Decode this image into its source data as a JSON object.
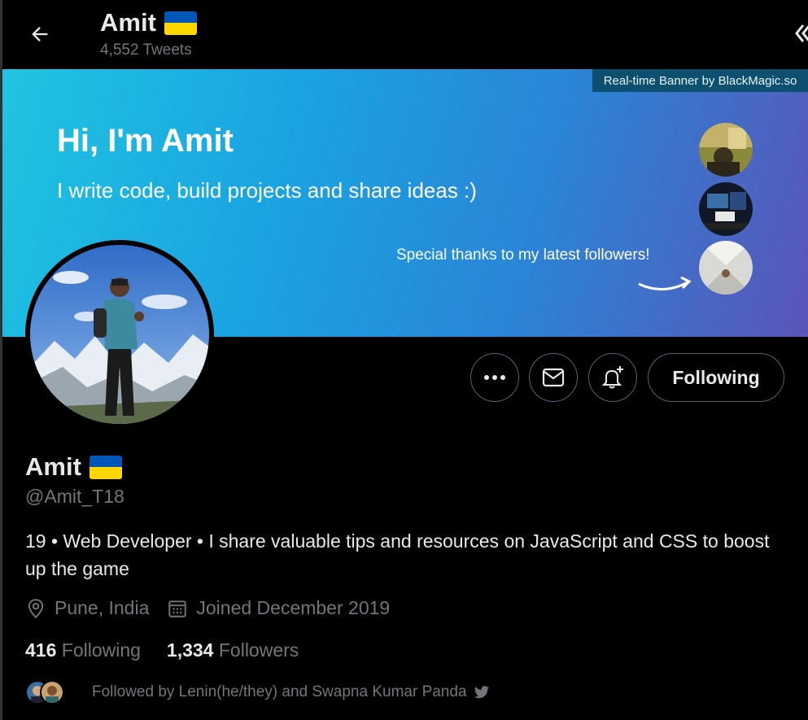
{
  "header": {
    "name": "Amit",
    "tweet_count": "4,552 Tweets",
    "flag": "ukraine-flag"
  },
  "banner": {
    "credit": "Real-time Banner by BlackMagic.so",
    "title": "Hi, I'm Amit",
    "subtitle": "I write code, build projects and share ideas :)",
    "thanks": "Special thanks to my latest followers!"
  },
  "actions": {
    "more_icon": "more-dots-icon",
    "message_icon": "envelope-icon",
    "notify_icon": "bell-plus-icon",
    "following_label": "Following"
  },
  "profile": {
    "name": "Amit",
    "handle": "@Amit_T18",
    "bio": "19 • Web Developer • I share valuable tips and resources on JavaScript and CSS to boost up the game",
    "location": "Pune, India",
    "joined": "Joined December 2019",
    "following_count": "416",
    "following_label": "Following",
    "followers_count": "1,334",
    "followers_label": "Followers",
    "followed_by": "Followed by Lenin(he/they) and Swapna Kumar Panda"
  },
  "colors": {
    "background": "#000000",
    "text_primary": "#e7e9ea",
    "text_secondary": "#71767b",
    "border": "#536471",
    "flag_blue": "#0057b7",
    "flag_yellow": "#ffd700"
  }
}
